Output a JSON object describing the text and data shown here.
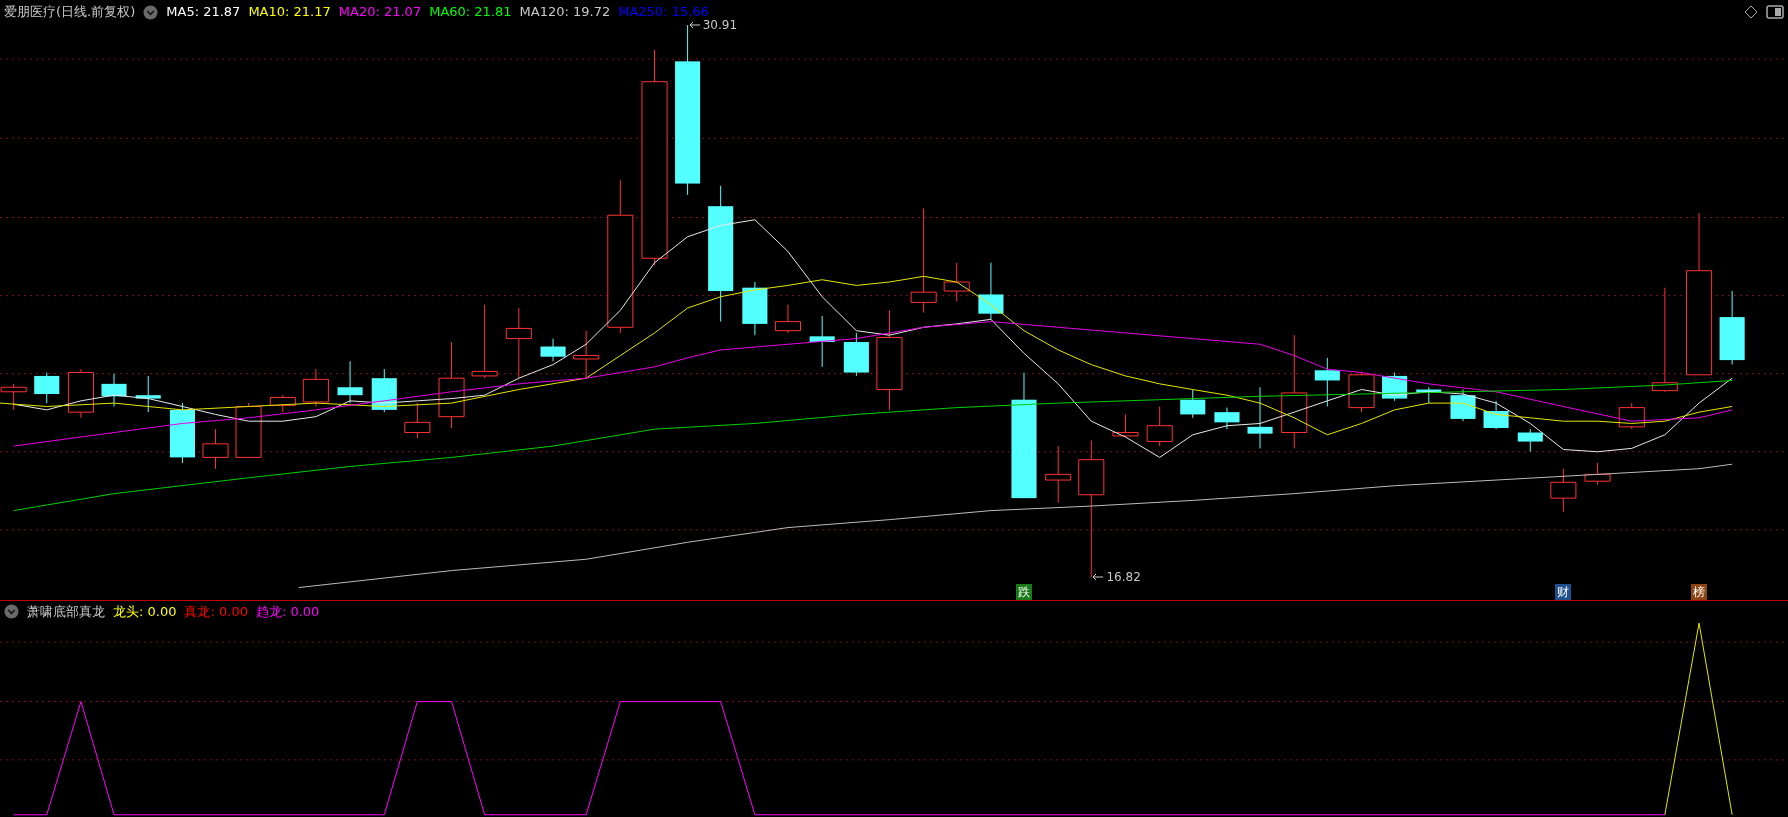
{
  "main_chart": {
    "title": "爱朋医疗(日线.前复权)",
    "moving_averages": [
      {
        "label": "MA5: 21.87",
        "color": "#ffffff"
      },
      {
        "label": "MA10: 21.17",
        "color": "#ffff00"
      },
      {
        "label": "MA20: 21.07",
        "color": "#ff00ff"
      },
      {
        "label": "MA60: 21.81",
        "color": "#00ff00"
      },
      {
        "label": "MA120: 19.72",
        "color": "#c8c8c8"
      },
      {
        "label": "MA250: 15.66",
        "color": "#0000ff"
      }
    ],
    "high_label": "30.91",
    "low_label": "16.82",
    "markers": [
      {
        "label": "跌",
        "color": "#1a7a1a"
      },
      {
        "label": "财",
        "color": "#1f4e8c"
      },
      {
        "label": "榜",
        "color": "#8b4513"
      }
    ]
  },
  "indicator": {
    "title": "萧啸底部真龙",
    "values": [
      {
        "label": "龙头: 0.00",
        "color": "#ffff00"
      },
      {
        "label": "真龙: 0.00",
        "color": "#ff0000"
      },
      {
        "label": "趋龙: 0.00",
        "color": "#ff00ff"
      }
    ]
  }
}
